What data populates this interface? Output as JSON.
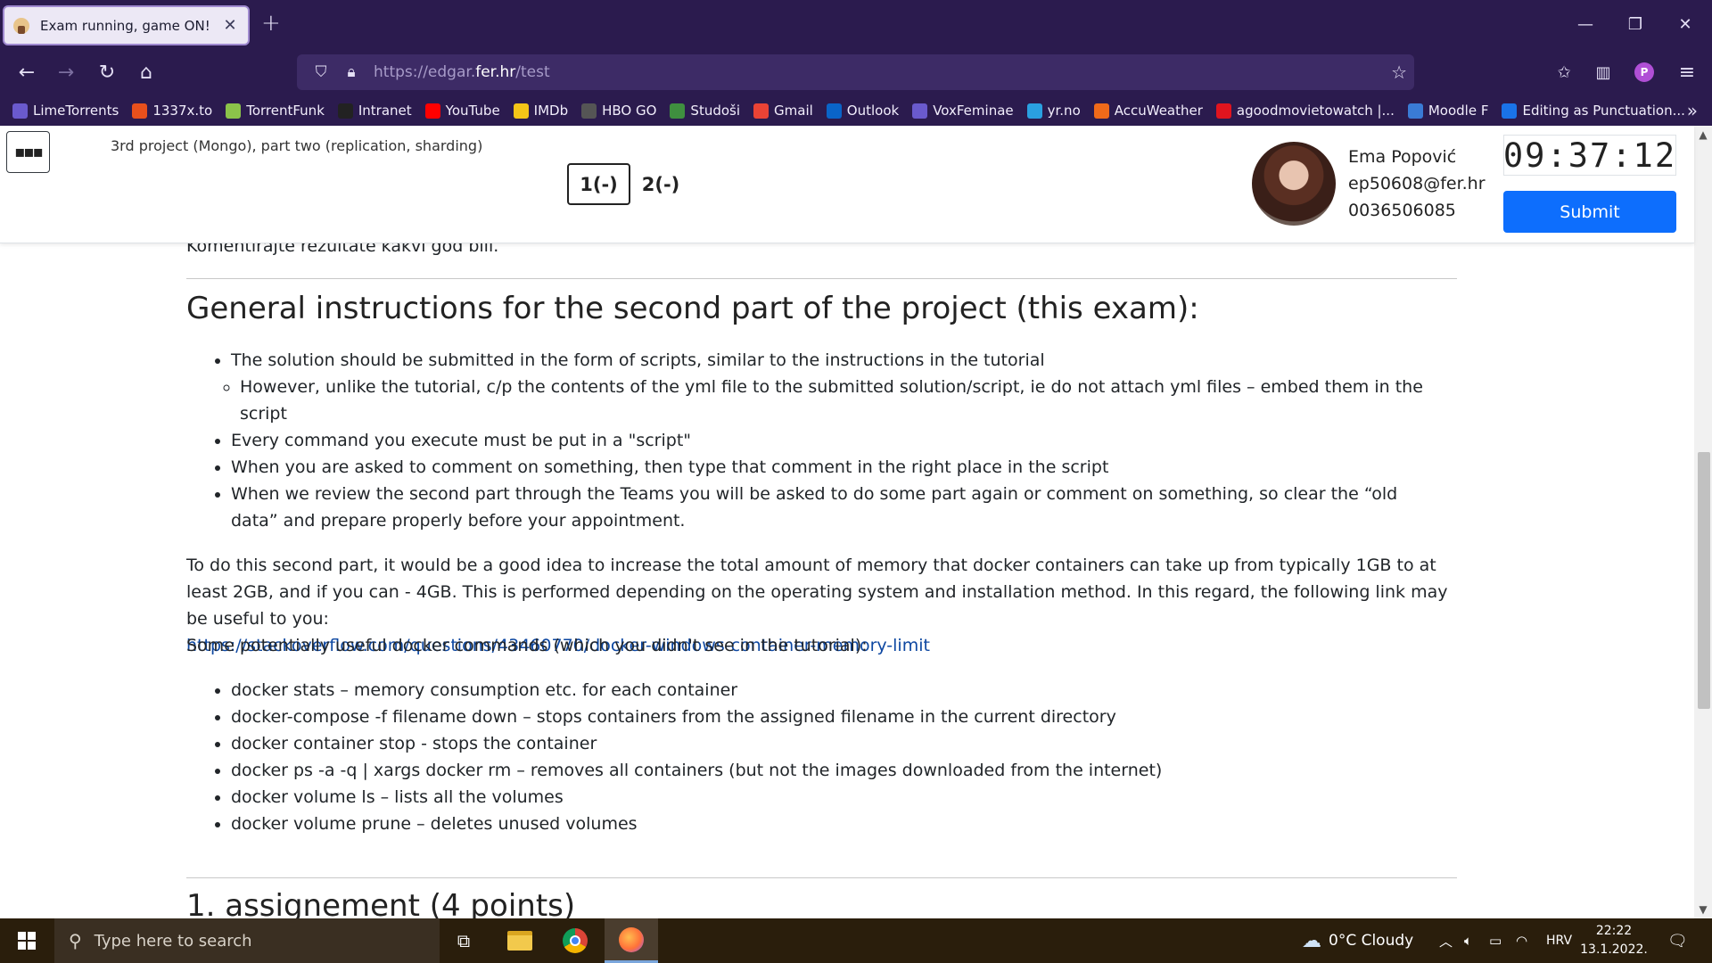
{
  "browser": {
    "tab_title": "Exam running, game ON!",
    "new_tab_symbol": "+",
    "url_prefix": "https://edgar.",
    "url_domain": "fer.hr",
    "url_path": "/test",
    "bookmarks": [
      {
        "label": "LimeTorrents",
        "icon": "globe-icon",
        "color": "#6a5acd"
      },
      {
        "label": "1337x.to",
        "icon": "x-icon",
        "color": "#e8501c"
      },
      {
        "label": "TorrentFunk",
        "icon": "sun-icon",
        "color": "#8bc34a"
      },
      {
        "label": "Intranet",
        "icon": "fer-icon",
        "color": "#222222"
      },
      {
        "label": "YouTube",
        "icon": "youtube-icon",
        "color": "#ff0000"
      },
      {
        "label": "IMDb",
        "icon": "imdb-icon",
        "color": "#f5c518"
      },
      {
        "label": "HBO GO",
        "icon": "hbo-icon",
        "color": "#555555"
      },
      {
        "label": "Studoši",
        "icon": "s-icon",
        "color": "#3f8f3f"
      },
      {
        "label": "Gmail",
        "icon": "gmail-icon",
        "color": "#ea4335"
      },
      {
        "label": "Outlook",
        "icon": "outlook-icon",
        "color": "#0a64c8"
      },
      {
        "label": "VoxFeminae",
        "icon": "globe-icon",
        "color": "#6a5acd"
      },
      {
        "label": "yr.no",
        "icon": "yr-icon",
        "color": "#2aa0e0"
      },
      {
        "label": "AccuWeather",
        "icon": "accuweather-icon",
        "color": "#f06a1a"
      },
      {
        "label": "agoodmovietowatch |...",
        "icon": "flag-icon",
        "color": "#e0141e"
      },
      {
        "label": "Moodle F",
        "icon": "moodle-icon",
        "color": "#3a7bd5"
      },
      {
        "label": "Editing as Punctuation...",
        "icon": "v-icon",
        "color": "#1a73e8"
      }
    ]
  },
  "exam": {
    "title": "3rd project (Mongo), part two (replication, sharding)",
    "questions": [
      "1(-)",
      "2(-)"
    ],
    "user_name": "Ema Popović",
    "user_email": "ep50608@fer.hr",
    "user_id": "0036506085",
    "timer": "09:37:12",
    "submit_label": "Submit"
  },
  "content": {
    "cut_text": "Komentirajte rezultate kakvi god bili.",
    "heading": "General instructions for the second part of the project (this exam):",
    "bullets": [
      "The solution should be submitted in the form of scripts, similar to the instructions in the tutorial",
      "Every command you execute must be put in a \"script\"",
      "When you are asked to comment on something, then type that comment in the right place in the script",
      "When we review the second part through the Teams you will be asked to do some part again or comment on something, so clear the “old data” and prepare properly before your appointment."
    ],
    "sub_bullet": "However, unlike the tutorial, c/p the contents of the yml file to the submitted solution/script, ie do not attach yml files – embed them in the script",
    "para1": "To do this second part, it would be a good idea to increase the total amount of memory that docker containers can take up from typically 1GB to at least 2GB, and if you can - 4GB. This is performed depending on the operating system and installation method. In this regard, the following link may be useful to you:",
    "link": "https://stackoverflow.com/questions/43460770/docker-windows-container-memory-limit",
    "para2": "Some potentially useful docker commands (which you didn't see in the tutorial):",
    "commands": [
      "docker stats – memory consumption etc. for each container",
      "docker-compose -f filename down – stops containers from the assigned filename in the current directory",
      "docker container stop - stops the container",
      "docker ps -a -q | xargs docker rm – removes all containers (but not the images downloaded from the internet)",
      "docker volume ls – lists all the volumes",
      "docker volume prune – deletes unused volumes"
    ],
    "next_heading": "1. assignement (4 points)"
  },
  "taskbar": {
    "search_placeholder": "Type here to search",
    "weather": "0°C  Cloudy",
    "language": "HRV",
    "time": "22:22",
    "date": "13.1.2022."
  }
}
